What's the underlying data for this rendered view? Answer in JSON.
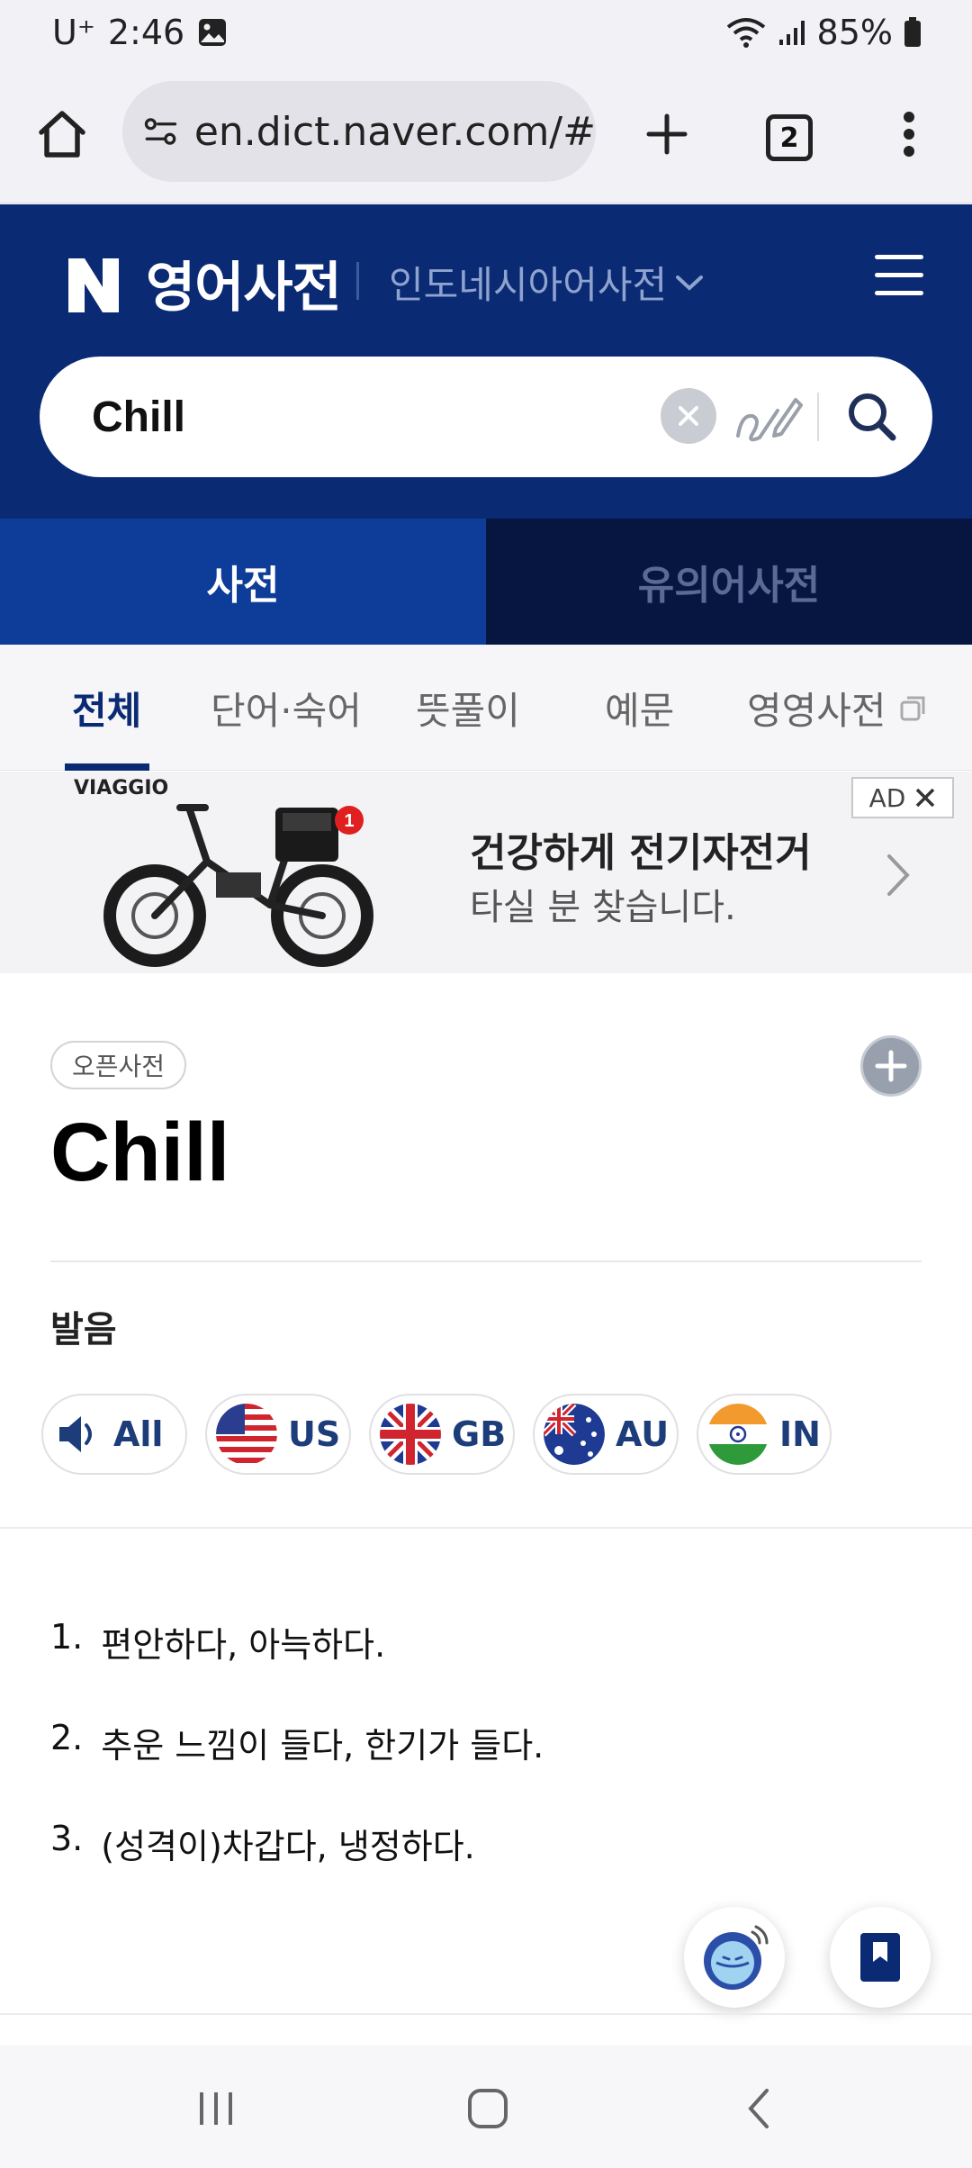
{
  "status_bar": {
    "carrier": "U⁺",
    "time": "2:46",
    "battery": "85%"
  },
  "browser": {
    "url": "en.dict.naver.com/#",
    "tab_count": "2"
  },
  "header": {
    "logo": "N",
    "title": "영어사전",
    "language_selector": "인도네시아어사전"
  },
  "search": {
    "query": "Chill"
  },
  "top_tabs": [
    {
      "label": "사전",
      "active": true
    },
    {
      "label": "유의어사전",
      "active": false
    }
  ],
  "sub_tabs": [
    {
      "label": "전체",
      "active": true
    },
    {
      "label": "단어·숙어",
      "active": false
    },
    {
      "label": "뜻풀이",
      "active": false
    },
    {
      "label": "예문",
      "active": false
    },
    {
      "label": "영영사전",
      "active": false
    }
  ],
  "ad": {
    "brand": "VIAGGIO",
    "badge_count": "1",
    "title": "건강하게 전기자전거",
    "subtitle": "타실 분 찾습니다.",
    "label": "AD"
  },
  "entry": {
    "source_badge": "오픈사전",
    "headword": "Chill",
    "pronunciation_title": "발음",
    "pronunciations": [
      {
        "label": "All",
        "icon": "speaker-icon"
      },
      {
        "label": "US",
        "icon": "us-flag-icon"
      },
      {
        "label": "GB",
        "icon": "gb-flag-icon"
      },
      {
        "label": "AU",
        "icon": "au-flag-icon"
      },
      {
        "label": "IN",
        "icon": "in-flag-icon"
      }
    ],
    "meanings": [
      {
        "num": "1.",
        "text": "편안하다, 아늑하다."
      },
      {
        "num": "2.",
        "text": "추운 느낌이 들다, 한기가 들다."
      },
      {
        "num": "3.",
        "text": "(성격이)차갑다, 냉정하다."
      }
    ]
  },
  "colors": {
    "header_bg": "#0a2a74",
    "active_tab": "#0d3d99",
    "inactive_tab": "#061641",
    "accent": "#0a2a74"
  }
}
